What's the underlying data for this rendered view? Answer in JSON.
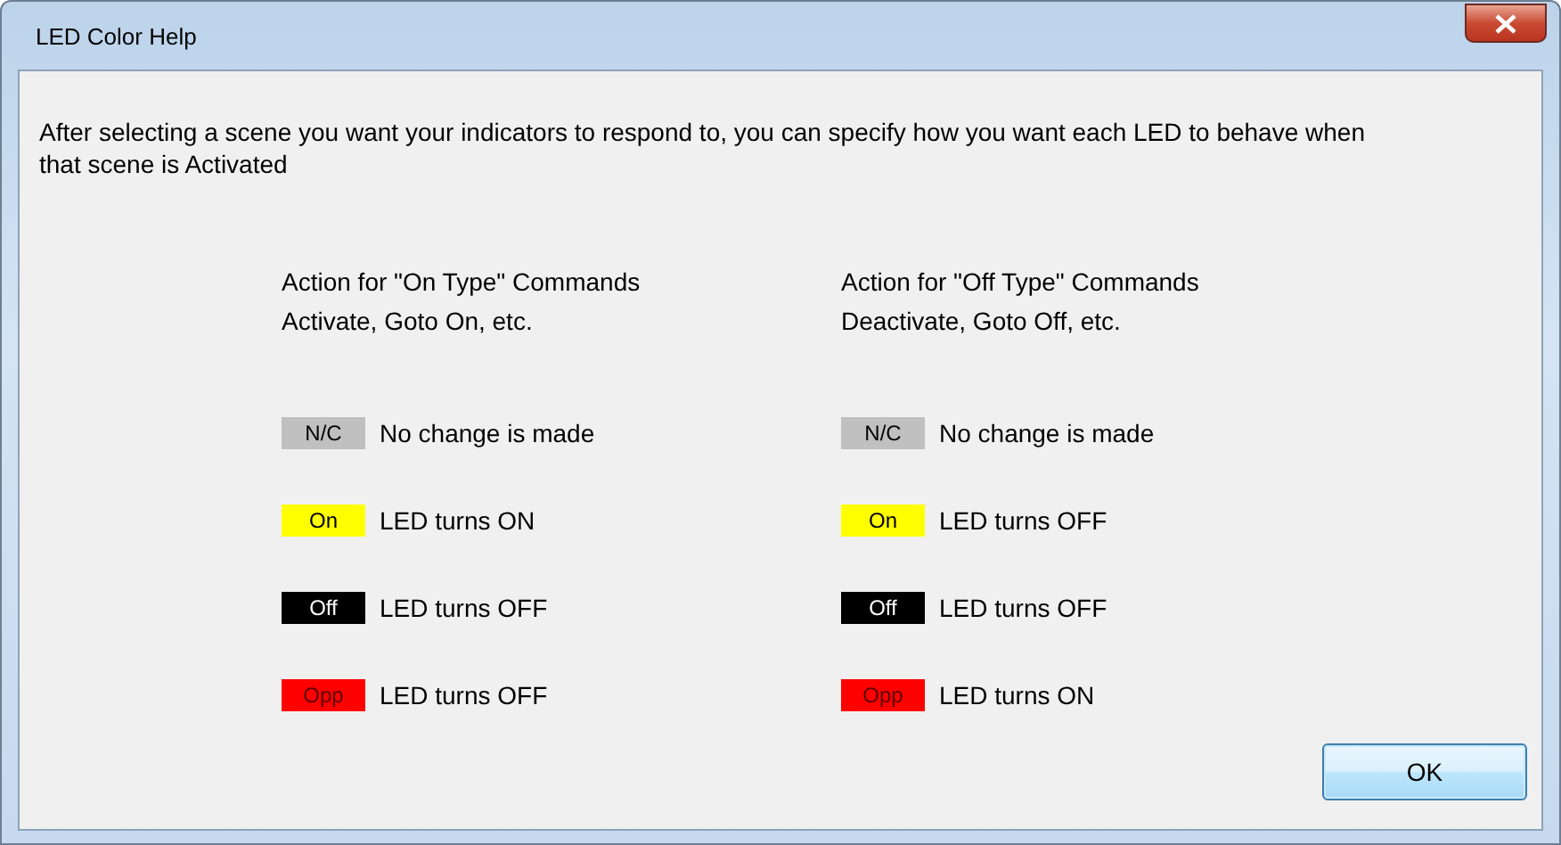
{
  "window": {
    "title": "LED Color Help"
  },
  "intro": "After selecting a scene you want your indicators to respond to, you can specify how you want each LED to behave when that scene is Activated",
  "columns": [
    {
      "heading": "Action for \"On Type\" Commands",
      "subheading": "Activate, Goto On, etc.",
      "rows": [
        {
          "badge": "N/C",
          "color": "#c0c0c0",
          "text": "No change is made"
        },
        {
          "badge": "On",
          "color": "#ffff00",
          "text": "LED turns ON"
        },
        {
          "badge": "Off",
          "color": "#000000",
          "text": "LED turns OFF"
        },
        {
          "badge": "Opp",
          "color": "#ff0000",
          "text": "LED turns OFF"
        }
      ]
    },
    {
      "heading": "Action for \"Off Type\" Commands",
      "subheading": "Deactivate, Goto Off, etc.",
      "rows": [
        {
          "badge": "N/C",
          "color": "#c0c0c0",
          "text": "No change is made"
        },
        {
          "badge": "On",
          "color": "#ffff00",
          "text": "LED turns OFF"
        },
        {
          "badge": "Off",
          "color": "#000000",
          "text": "LED turns OFF"
        },
        {
          "badge": "Opp",
          "color": "#ff0000",
          "text": "LED turns ON"
        }
      ]
    }
  ],
  "buttons": [
    "OK"
  ]
}
